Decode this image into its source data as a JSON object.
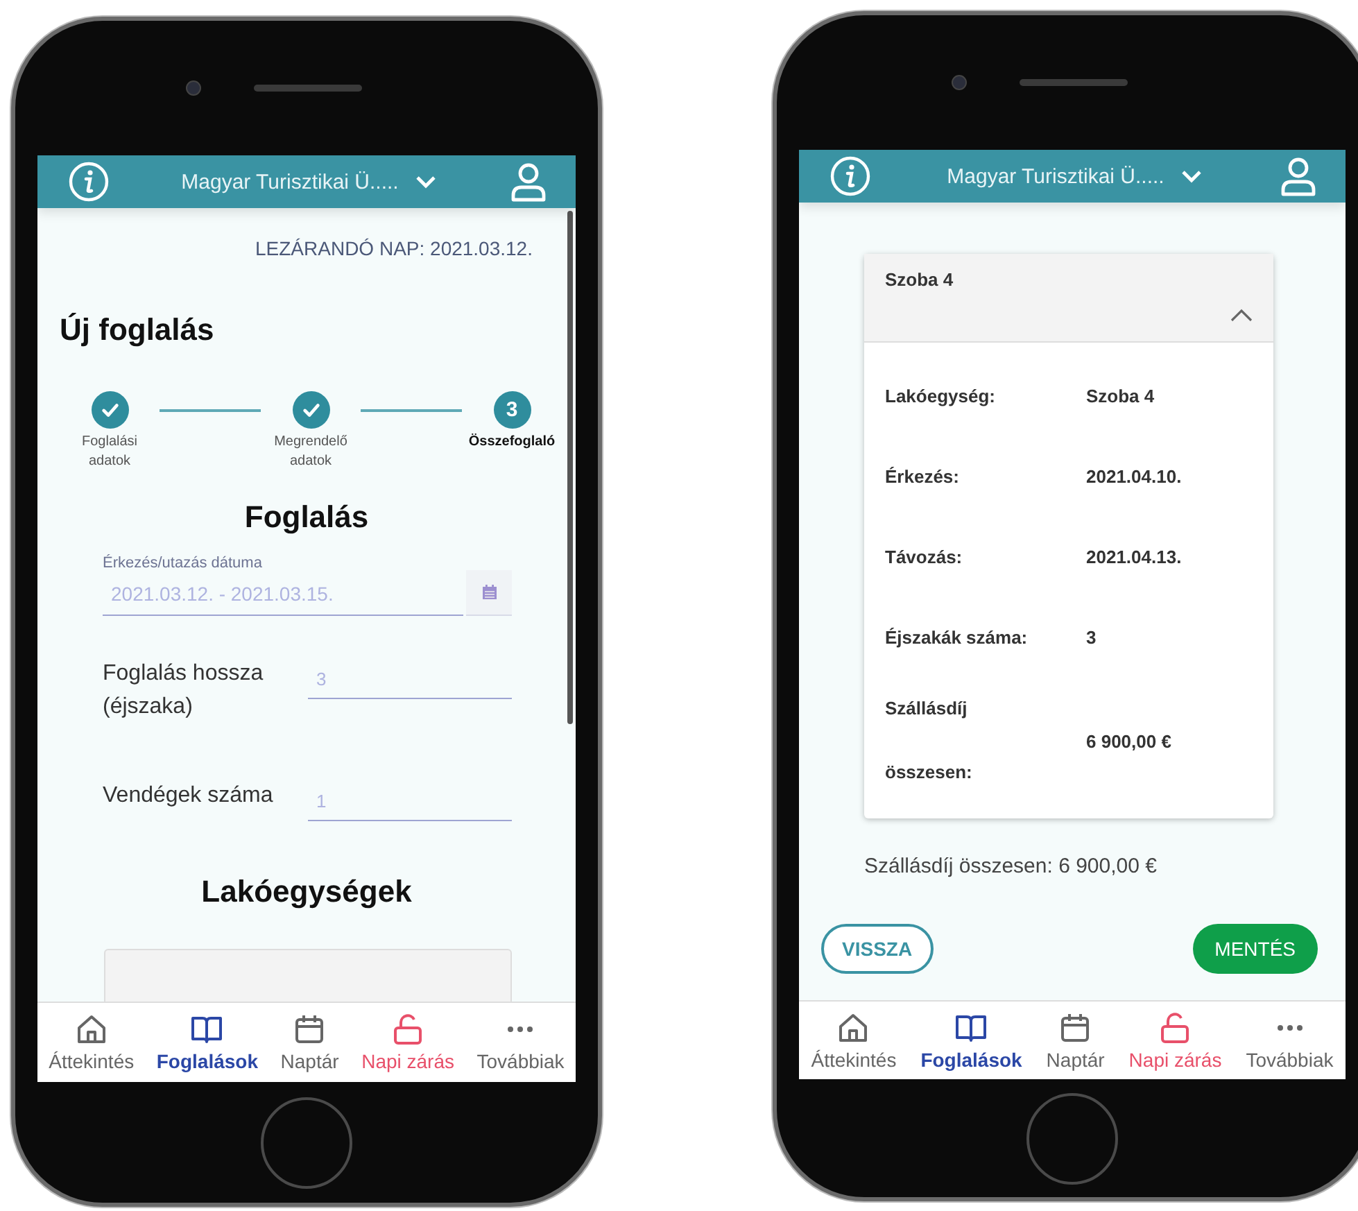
{
  "screens": [
    {
      "header": {
        "title": "Magyar Turisztikai Ü....."
      },
      "closing_day": "LEZÁRANDÓ NAP: 2021.03.12.",
      "title": "Új foglalás",
      "steps": [
        {
          "label": "Foglalási adatok",
          "kind": "done",
          "selected": false
        },
        {
          "label": "Megrendelő adatok",
          "kind": "done",
          "selected": false
        },
        {
          "label": "Összefoglaló",
          "kind": "current",
          "number": "3",
          "selected": true
        }
      ],
      "section_title": "Foglalás",
      "date_field": {
        "label": "Érkezés/utazás dátuma",
        "value": "2021.03.12. - 2021.03.15."
      },
      "fields": [
        {
          "label": "Foglalás hossza (éjszaka)",
          "value": "3"
        },
        {
          "label": "Vendégek száma",
          "value": "1"
        }
      ],
      "units_title": "Lakóegységek",
      "nav": [
        {
          "label": "Áttekintés",
          "kind": "home",
          "selected": false
        },
        {
          "label": "Foglalások",
          "kind": "book",
          "selected": true
        },
        {
          "label": "Naptár",
          "kind": "calendar",
          "selected": false
        },
        {
          "label": "Napi zárás",
          "kind": "lock",
          "selected": false
        },
        {
          "label": "Továbbiak",
          "kind": "more",
          "selected": false
        }
      ]
    },
    {
      "header": {
        "title": "Magyar Turisztikai Ü....."
      },
      "unit_card": {
        "title": "Szoba 4",
        "expanded": true,
        "rows": [
          {
            "label": "Lakóegység:",
            "value": "Szoba 4"
          },
          {
            "label": "Érkezés:",
            "value": "2021.04.10."
          },
          {
            "label": "Távozás:",
            "value": "2021.04.13."
          },
          {
            "label": "Éjszakák száma:",
            "value": "3"
          },
          {
            "label": "Szállásdíj összesen:",
            "value": "6 900,00 €"
          }
        ]
      },
      "total": "Szállásdíj összesen: 6 900,00 €",
      "buttons": [
        {
          "label": "VISSZA",
          "kind": "outline"
        },
        {
          "label": "MENTÉS",
          "kind": "primary"
        }
      ],
      "nav": [
        {
          "label": "Áttekintés",
          "kind": "home",
          "selected": false
        },
        {
          "label": "Foglalások",
          "kind": "book",
          "selected": true
        },
        {
          "label": "Naptár",
          "kind": "calendar",
          "selected": false
        },
        {
          "label": "Napi zárás",
          "kind": "lock",
          "selected": false
        },
        {
          "label": "Továbbiak",
          "kind": "more",
          "selected": false
        }
      ]
    }
  ]
}
